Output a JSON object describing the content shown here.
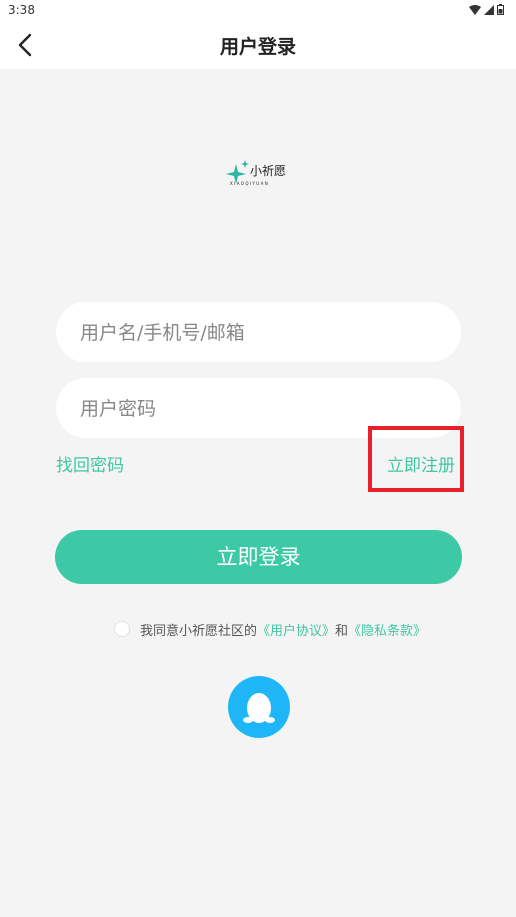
{
  "status_bar": {
    "time": "3:38"
  },
  "header": {
    "title": "用户登录"
  },
  "logo": {
    "text_cn": "小祈愿",
    "text_en": "XIAOQIYUAN"
  },
  "form": {
    "username_placeholder": "用户名/手机号/邮箱",
    "password_placeholder": "用户密码",
    "forgot_password": "找回密码",
    "register": "立即注册",
    "login_button": "立即登录"
  },
  "agreement": {
    "prefix": "我同意小祈愿社区的",
    "user_agreement": "《用户协议》",
    "and": "和",
    "privacy_policy": "《隐私条款》"
  },
  "colors": {
    "accent": "#3ec9a6",
    "qq": "#1eb6f6",
    "highlight": "#e8202a"
  }
}
